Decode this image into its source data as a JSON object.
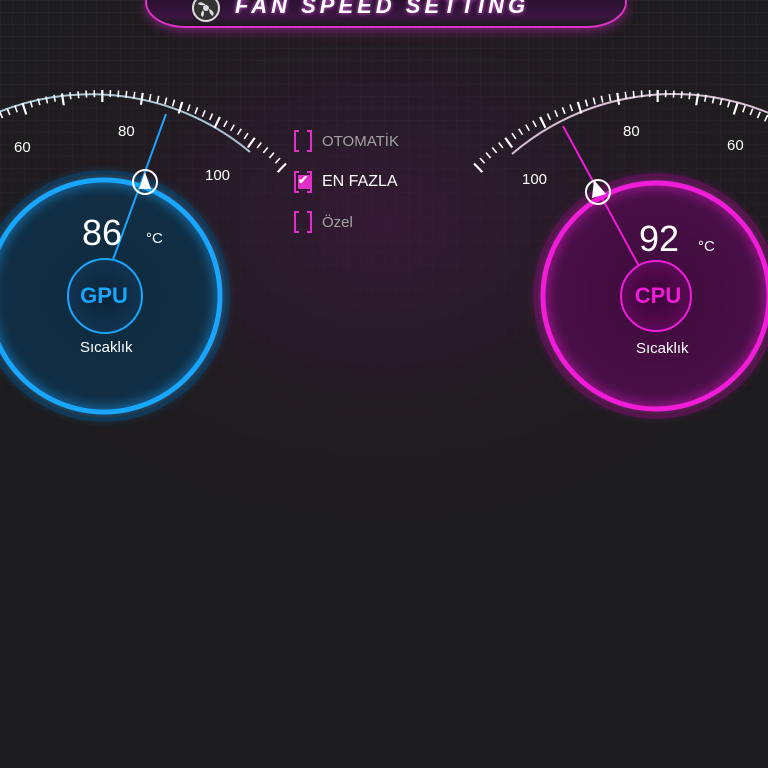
{
  "header": {
    "title": "FAN SPEED SETTING"
  },
  "gpu": {
    "hub_label": "GPU",
    "temperature": "86",
    "unit": "°C",
    "label": "Sıcaklık",
    "scale": [
      "60",
      "80",
      "100"
    ],
    "accent": "#19a6ff"
  },
  "cpu": {
    "hub_label": "CPU",
    "temperature": "92",
    "unit": "°C",
    "label": "Sıcaklık",
    "scale": [
      "100",
      "80",
      "60"
    ],
    "accent": "#f01cd8"
  },
  "modes": [
    {
      "label": "OTOMATİK",
      "checked": false
    },
    {
      "label": "EN FAZLA",
      "checked": true
    },
    {
      "label": "Özel",
      "checked": false
    }
  ],
  "colors": {
    "checkbox_accent": "#e030c8",
    "background": "#1d1c1e"
  }
}
